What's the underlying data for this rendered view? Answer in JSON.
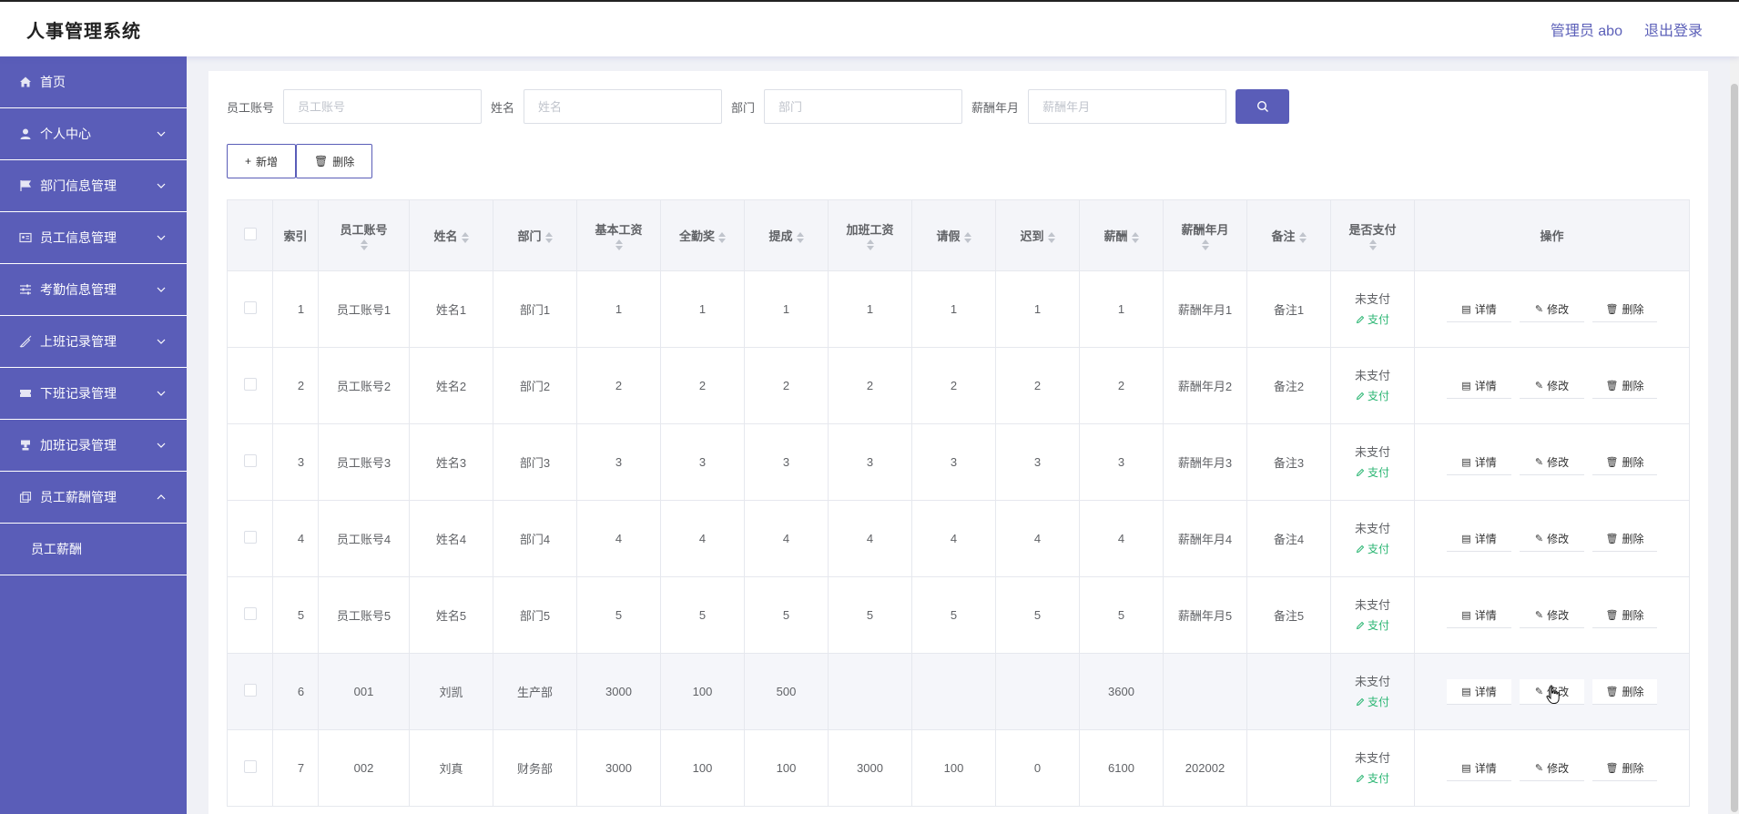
{
  "header": {
    "app_title": "人事管理系统",
    "user": "管理员 abo",
    "logout": "退出登录"
  },
  "sidebar": {
    "items": [
      {
        "label": "首页",
        "icon": "home-icon"
      },
      {
        "label": "个人中心",
        "icon": "user-icon"
      },
      {
        "label": "部门信息管理",
        "icon": "flag-icon"
      },
      {
        "label": "员工信息管理",
        "icon": "id-card-icon"
      },
      {
        "label": "考勤信息管理",
        "icon": "sliders-icon"
      },
      {
        "label": "上班记录管理",
        "icon": "pencil-off-icon"
      },
      {
        "label": "下班记录管理",
        "icon": "ticket-icon"
      },
      {
        "label": "加班记录管理",
        "icon": "stamp-icon"
      },
      {
        "label": "员工薪酬管理",
        "icon": "copy-icon"
      }
    ],
    "submenu": "员工薪酬"
  },
  "search": {
    "account_label": "员工账号",
    "account_placeholder": "员工账号",
    "name_label": "姓名",
    "name_placeholder": "姓名",
    "dept_label": "部门",
    "dept_placeholder": "部门",
    "month_label": "薪酬年月",
    "month_placeholder": "薪酬年月"
  },
  "actions": {
    "add": "新增",
    "delete": "删除"
  },
  "table": {
    "columns": [
      "索引",
      "员工账号",
      "姓名",
      "部门",
      "基本工资",
      "全勤奖",
      "提成",
      "加班工资",
      "请假",
      "迟到",
      "薪酬",
      "薪酬年月",
      "备注",
      "是否支付",
      "操作"
    ],
    "rows": [
      {
        "index": "1",
        "account": "员工账号1",
        "name": "姓名1",
        "dept": "部门1",
        "base": "1",
        "bonus": "1",
        "commission": "1",
        "overtime": "1",
        "leave": "1",
        "late": "1",
        "salary": "1",
        "month": "薪酬年月1",
        "note": "备注1"
      },
      {
        "index": "2",
        "account": "员工账号2",
        "name": "姓名2",
        "dept": "部门2",
        "base": "2",
        "bonus": "2",
        "commission": "2",
        "overtime": "2",
        "leave": "2",
        "late": "2",
        "salary": "2",
        "month": "薪酬年月2",
        "note": "备注2"
      },
      {
        "index": "3",
        "account": "员工账号3",
        "name": "姓名3",
        "dept": "部门3",
        "base": "3",
        "bonus": "3",
        "commission": "3",
        "overtime": "3",
        "leave": "3",
        "late": "3",
        "salary": "3",
        "month": "薪酬年月3",
        "note": "备注3"
      },
      {
        "index": "4",
        "account": "员工账号4",
        "name": "姓名4",
        "dept": "部门4",
        "base": "4",
        "bonus": "4",
        "commission": "4",
        "overtime": "4",
        "leave": "4",
        "late": "4",
        "salary": "4",
        "month": "薪酬年月4",
        "note": "备注4"
      },
      {
        "index": "5",
        "account": "员工账号5",
        "name": "姓名5",
        "dept": "部门5",
        "base": "5",
        "bonus": "5",
        "commission": "5",
        "overtime": "5",
        "leave": "5",
        "late": "5",
        "salary": "5",
        "month": "薪酬年月5",
        "note": "备注5"
      },
      {
        "index": "6",
        "account": "001",
        "name": "刘凯",
        "dept": "生产部",
        "base": "3000",
        "bonus": "100",
        "commission": "500",
        "overtime": "",
        "leave": "",
        "late": "",
        "salary": "3600",
        "month": "",
        "note": ""
      },
      {
        "index": "7",
        "account": "002",
        "name": "刘真",
        "dept": "财务部",
        "base": "3000",
        "bonus": "100",
        "commission": "100",
        "overtime": "3000",
        "leave": "100",
        "late": "0",
        "salary": "6100",
        "month": "202002",
        "note": ""
      }
    ],
    "pay_status": "未支付",
    "pay_action": "支付",
    "op_detail": "详情",
    "op_edit": "修改",
    "op_delete": "删除"
  },
  "colors": {
    "accent": "#5a5db8",
    "pay_green": "#2bb673"
  }
}
